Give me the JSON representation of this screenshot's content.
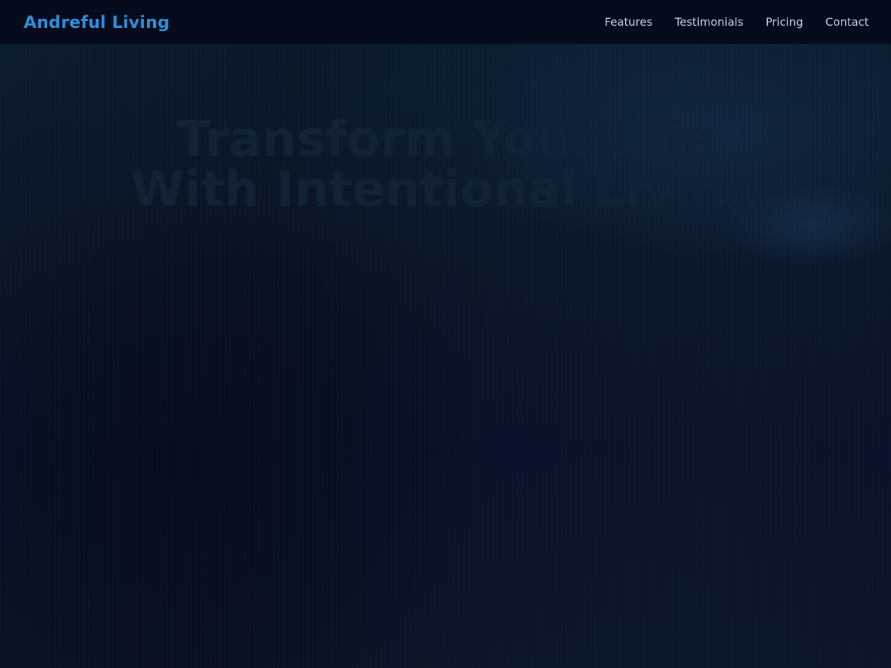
{
  "brand": {
    "name": "Andreful Living"
  },
  "nav": {
    "items": [
      {
        "label": "Features"
      },
      {
        "label": "Testimonials"
      },
      {
        "label": "Pricing"
      },
      {
        "label": "Contact"
      }
    ]
  },
  "hero": {
    "title_line1": "Transform Your Life",
    "title_line2": "With Intentional Living"
  },
  "colors": {
    "brand_accent": "#2f8fd8",
    "nav_background": "#050b1d",
    "nav_text": "#c2cad8",
    "hero_background": "#0a1629",
    "hero_title": "#122338"
  }
}
